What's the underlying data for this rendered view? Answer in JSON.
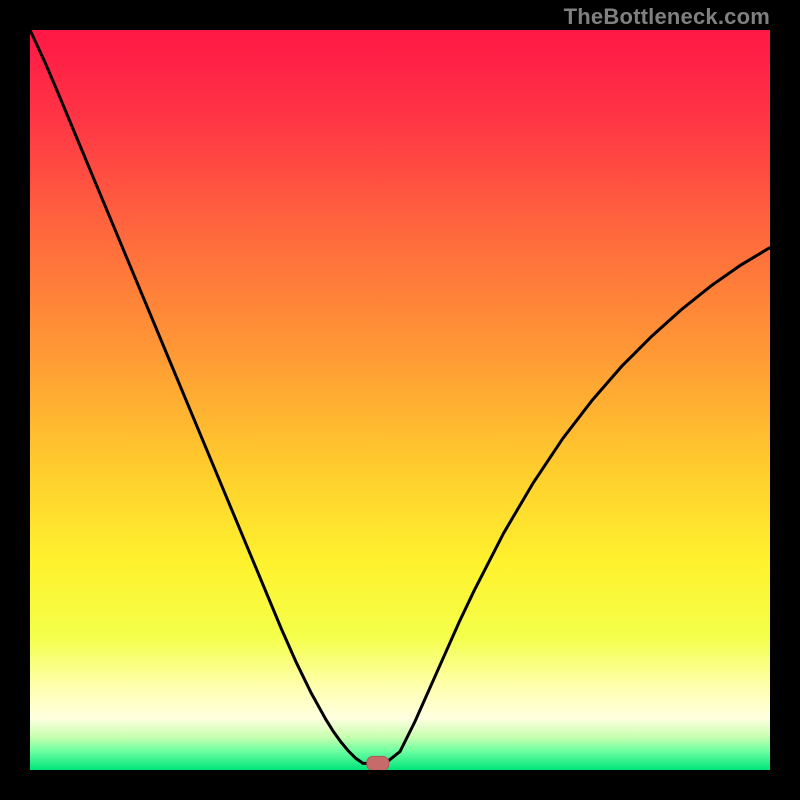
{
  "watermark": "TheBottleneck.com",
  "chart_data": {
    "type": "line",
    "title": "",
    "xlabel": "",
    "ylabel": "",
    "xlim": [
      0,
      100
    ],
    "ylim": [
      0,
      100
    ],
    "grid": false,
    "series": [
      {
        "name": "bottleneck-curve",
        "x": [
          0,
          2,
          4,
          6,
          8,
          10,
          12,
          14,
          16,
          18,
          20,
          22,
          24,
          26,
          28,
          30,
          32,
          34,
          36,
          38,
          40,
          41,
          42,
          43,
          44,
          45,
          46,
          47,
          48,
          50,
          52,
          54,
          56,
          58,
          60,
          64,
          68,
          72,
          76,
          80,
          84,
          88,
          92,
          96,
          100
        ],
        "values": [
          100,
          95.7,
          91,
          86.2,
          81.4,
          76.6,
          71.8,
          67,
          62.2,
          57.4,
          52.6,
          47.8,
          43,
          38.2,
          33.4,
          28.6,
          23.8,
          19,
          14.5,
          10.4,
          6.8,
          5.2,
          3.8,
          2.6,
          1.6,
          0.9,
          0.9,
          0.9,
          0.9,
          2.5,
          6.5,
          11,
          15.5,
          20,
          24.2,
          32,
          38.8,
          44.8,
          50,
          54.6,
          58.6,
          62.2,
          65.4,
          68.2,
          70.6
        ]
      }
    ],
    "marker": {
      "x": 47,
      "y": 0.9
    },
    "background_gradient_stops": [
      {
        "offset": 0.0,
        "color": "#ff1846"
      },
      {
        "offset": 0.12,
        "color": "#ff3545"
      },
      {
        "offset": 0.28,
        "color": "#ff6a3d"
      },
      {
        "offset": 0.44,
        "color": "#ff9a35"
      },
      {
        "offset": 0.6,
        "color": "#ffcf2d"
      },
      {
        "offset": 0.72,
        "color": "#fff22e"
      },
      {
        "offset": 0.82,
        "color": "#f4ff4a"
      },
      {
        "offset": 0.89,
        "color": "#ffffb3"
      },
      {
        "offset": 0.93,
        "color": "#ffffe0"
      },
      {
        "offset": 0.955,
        "color": "#c8ffb0"
      },
      {
        "offset": 0.975,
        "color": "#6affa0"
      },
      {
        "offset": 1.0,
        "color": "#00e47a"
      }
    ]
  }
}
